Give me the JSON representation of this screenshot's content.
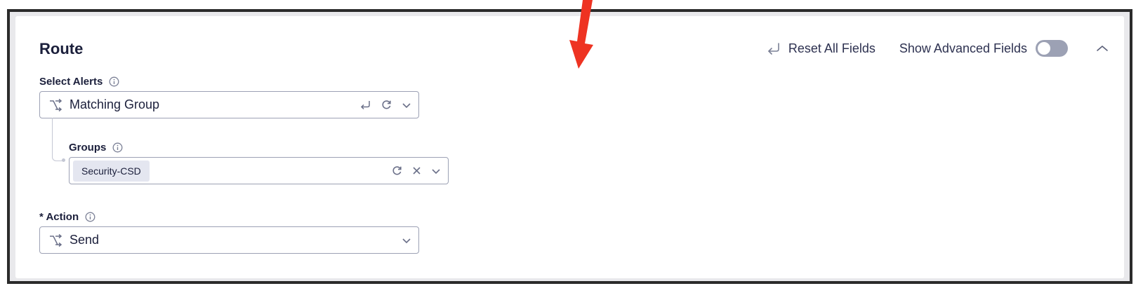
{
  "section": {
    "title": "Route",
    "reset_label": "Reset All Fields",
    "advanced_label": "Show Advanced Fields",
    "advanced_enabled": false
  },
  "select_alerts": {
    "label": "Select Alerts",
    "value": "Matching Group"
  },
  "groups": {
    "label": "Groups",
    "chips": [
      "Security-CSD"
    ]
  },
  "action": {
    "label": "* Action",
    "value": "Send"
  },
  "colors": {
    "annotation_arrow": "#ee3322",
    "title": "#1b1f3b",
    "toggle_off": "#9ca1b4"
  }
}
